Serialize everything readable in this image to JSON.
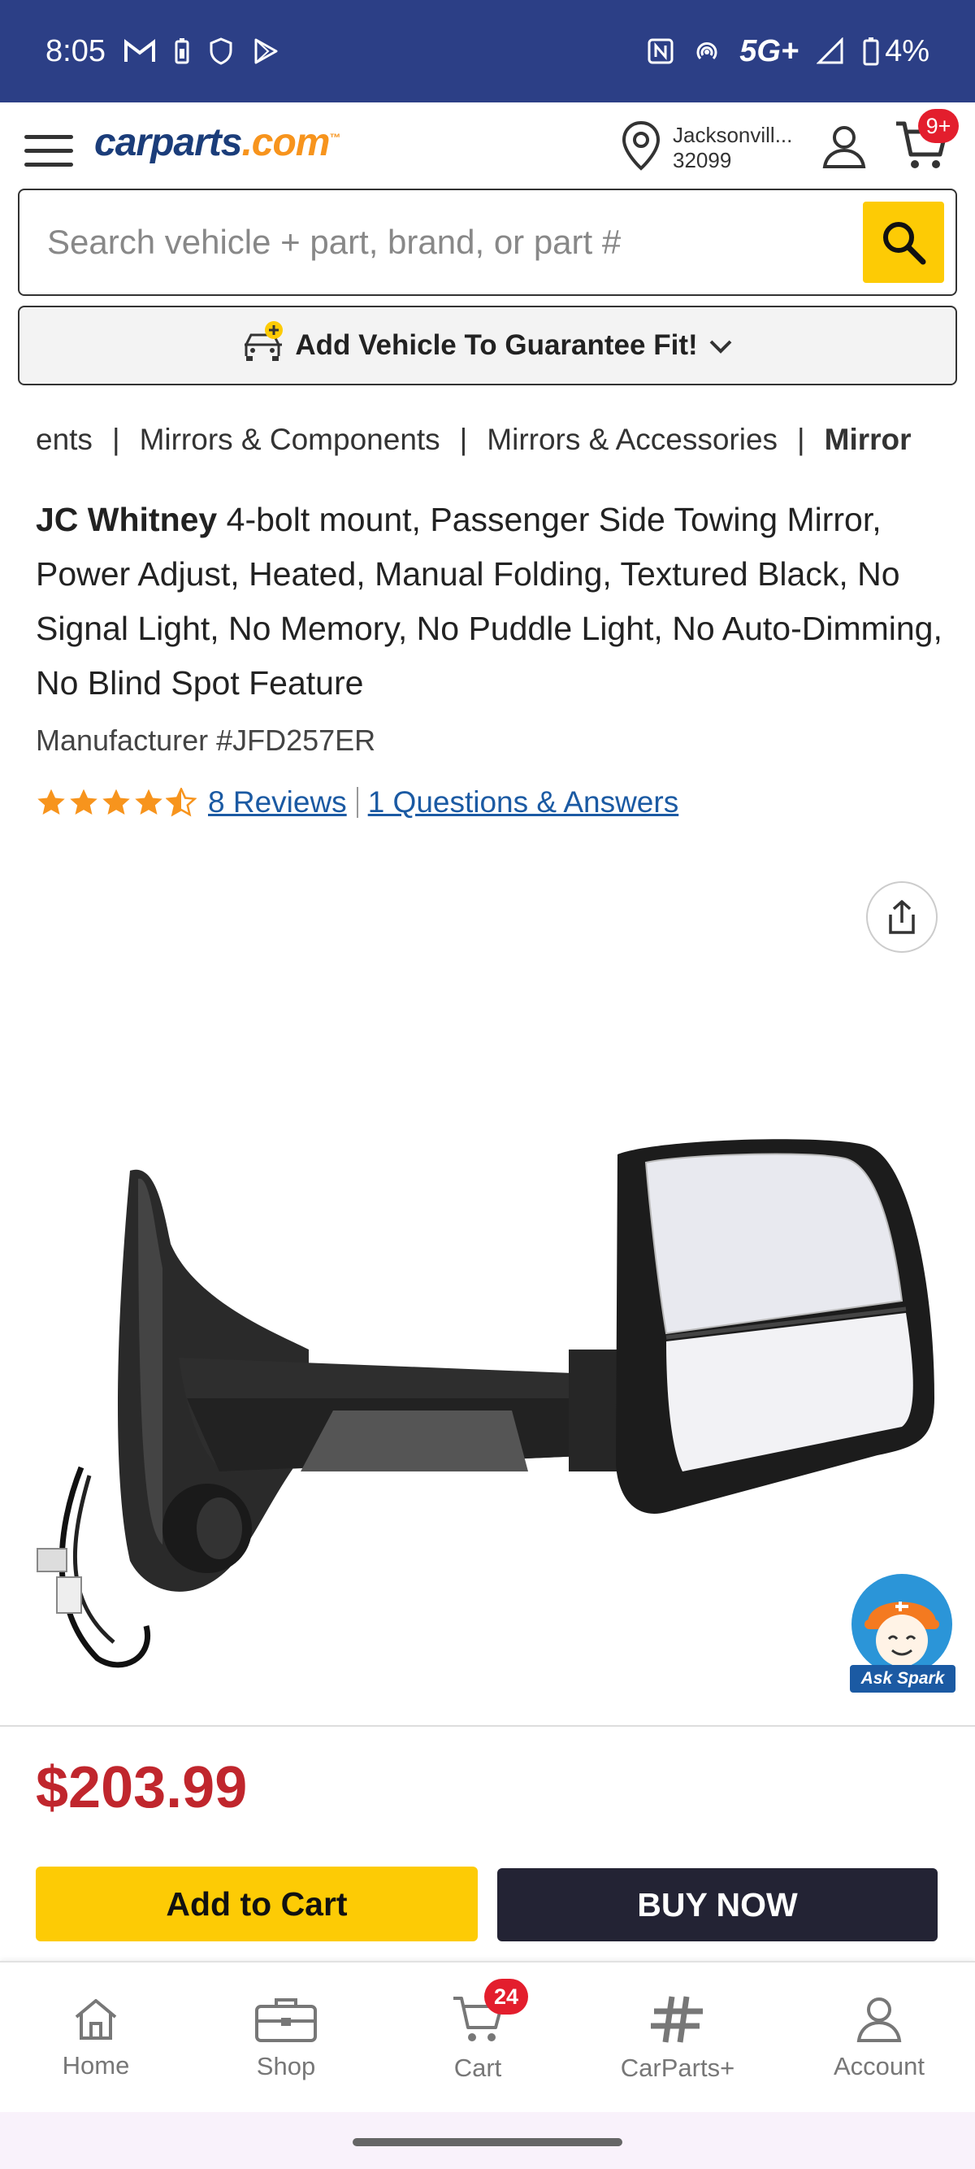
{
  "status_bar": {
    "time": "8:05",
    "network": "5G+",
    "battery": "4%"
  },
  "header": {
    "logo_main": "carparts",
    "logo_dot": ".com",
    "logo_tm": "™",
    "location_city": "Jacksonvill...",
    "location_zip": "32099",
    "cart_badge": "9+"
  },
  "search": {
    "placeholder": "Search vehicle + part, brand, or part #"
  },
  "add_vehicle": {
    "label": "Add Vehicle To Guarantee Fit!"
  },
  "breadcrumb": {
    "items": [
      "ents",
      "Mirrors & Components",
      "Mirrors & Accessories",
      "Mirror"
    ],
    "separator": "|"
  },
  "product": {
    "brand": "JC Whitney",
    "title": "4-bolt mount, Passenger Side Towing Mirror, Power Adjust, Heated, Manual Folding, Textured Black, No Signal Light, No Memory, No Puddle Light, No Auto-Dimming, No Blind Spot Feature",
    "manufacturer_number": "Manufacturer #JFD257ER",
    "rating": 4.5,
    "reviews_label": "8 Reviews",
    "qa_label": "1 Questions & Answers",
    "image_alt": "passenger-side-towing-mirror",
    "price": "$203.99"
  },
  "spark": {
    "label": "Ask Spark"
  },
  "actions": {
    "add_to_cart": "Add to Cart",
    "buy_now": "BUY NOW"
  },
  "tabbar": {
    "items": [
      {
        "label": "Home",
        "icon": "home-icon"
      },
      {
        "label": "Shop",
        "icon": "toolbox-icon"
      },
      {
        "label": "Cart",
        "icon": "cart-icon",
        "badge": "24"
      },
      {
        "label": "CarParts+",
        "icon": "carparts-plus-icon"
      },
      {
        "label": "Account",
        "icon": "account-icon"
      }
    ]
  },
  "colors": {
    "status_bar": "#2c3f86",
    "accent_yellow": "#fdcb05",
    "price_red": "#c0262d",
    "link_blue": "#1b5aa3",
    "star_orange": "#f7941d"
  }
}
